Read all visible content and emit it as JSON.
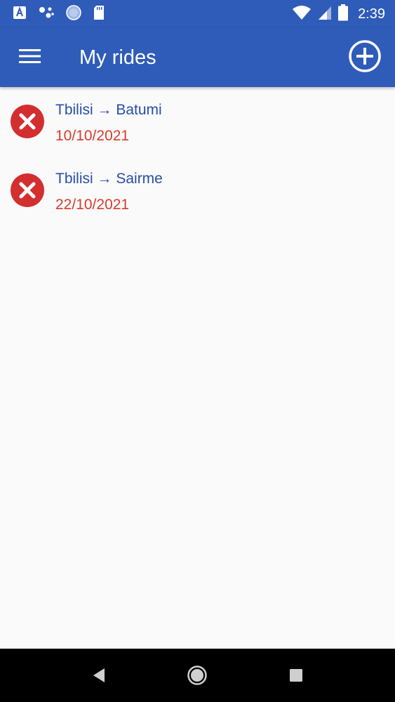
{
  "status_bar": {
    "time": "2:39",
    "icons": [
      "font-app-icon",
      "assistant-icon",
      "circle-app-icon",
      "sd-card-icon",
      "wifi-icon",
      "signal-icon",
      "battery-icon"
    ]
  },
  "app_bar": {
    "title": "My rides",
    "menu_icon": "menu-icon",
    "add_icon": "add-circle-icon"
  },
  "rides": [
    {
      "route": "Tbilisi → Batumi",
      "date": "10/10/2021"
    },
    {
      "route": "Tbilisi → Sairme",
      "date": "22/10/2021"
    }
  ],
  "colors": {
    "primary": "#2f5cb8",
    "route_text": "#274ea7",
    "date_text": "#d93a2b",
    "delete_icon": "#d32f2f",
    "background": "#fafafa"
  },
  "nav_bar": {
    "icons": [
      "back-icon",
      "home-icon",
      "recents-icon"
    ]
  }
}
